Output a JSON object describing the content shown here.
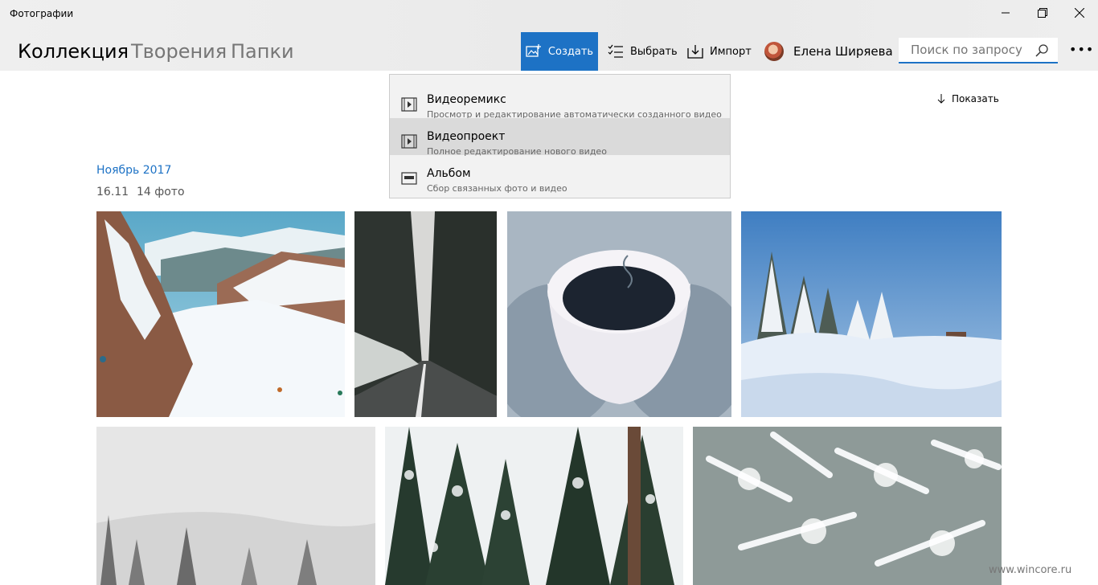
{
  "app": {
    "title": "Фотографии"
  },
  "window_controls": {
    "minimize_icon": "minimize-icon",
    "maximize_icon": "restore-icon",
    "close_icon": "close-icon"
  },
  "pivot": [
    {
      "label": "Коллекция",
      "selected": true
    },
    {
      "label": "Творения",
      "selected": false
    },
    {
      "label": "Папки",
      "selected": false
    }
  ],
  "toolbar": {
    "create_label": "Создать",
    "select_label": "Выбрать",
    "import_label": "Импорт",
    "user_name": "Елена Ширяева",
    "search_placeholder": "Поиск по запросу \"",
    "more_icon": "more-icon",
    "accent": "#1d72c5"
  },
  "create_menu": [
    {
      "title": "Видеоремикс",
      "description": "Просмотр и редактирование автоматически созданного видео",
      "icon": "video-remix-icon",
      "highlighted": false
    },
    {
      "title": "Видеопроект",
      "description": "Полное редактирование нового видео",
      "icon": "video-project-icon",
      "highlighted": true
    },
    {
      "title": "Альбом",
      "description": "Сбор связанных фото и видео",
      "icon": "album-icon",
      "highlighted": false
    }
  ],
  "view": {
    "show_label": "Показать",
    "show_icon": "arrow-down-icon"
  },
  "collection": {
    "month": "Ноябрь 2017",
    "date": "16.11",
    "count": "14 фото"
  },
  "photos": [
    {
      "name": "photo-mountain-ski-slope"
    },
    {
      "name": "photo-forest-road"
    },
    {
      "name": "photo-coffee-cup-mittens"
    },
    {
      "name": "photo-snowy-trees-blue-sky"
    },
    {
      "name": "photo-foggy-snowy-hill"
    },
    {
      "name": "photo-snowy-pine-forest"
    },
    {
      "name": "photo-frosted-fir-branches"
    }
  ],
  "watermark": "www.wincore.ru"
}
